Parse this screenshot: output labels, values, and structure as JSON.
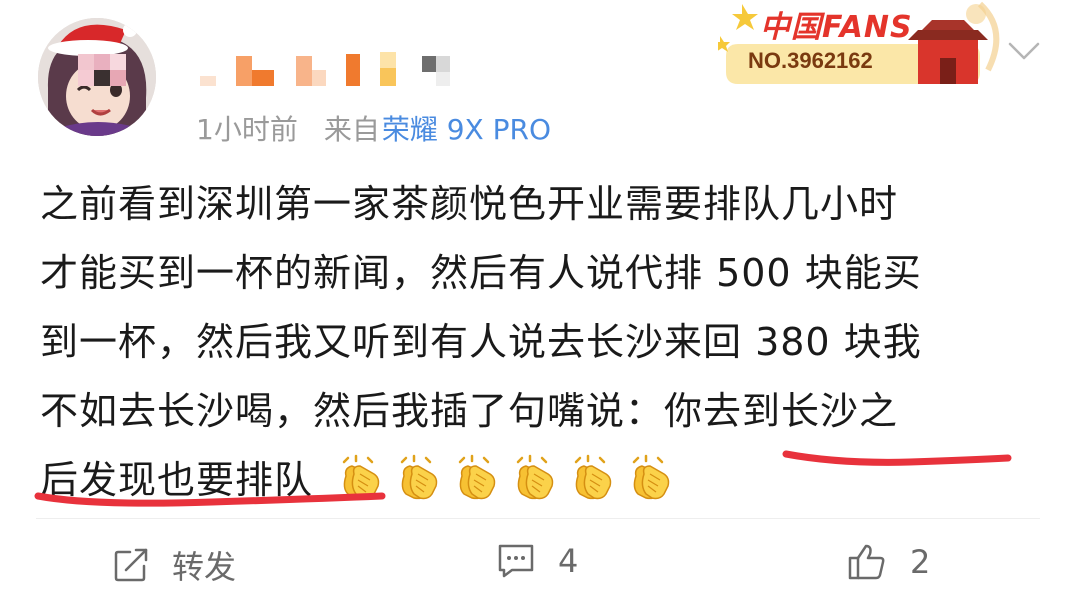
{
  "post": {
    "time": "1小时前",
    "from_prefix": "来自",
    "device": "荣耀 9X PRO",
    "lines": [
      "之前看到深圳第一家茶颜悦色开业需要排队几小时",
      "才能买到一杯的新闻，然后有人说代排 500 块能买",
      "到一杯，然后我又听到有人说去长沙来回 380 块我",
      "不如去长沙喝，然后我插了句嘴说：你去到长沙之",
      "后发现也要排队"
    ],
    "emoji": "clapping-hands",
    "emoji_count": 6
  },
  "badge": {
    "title": "中国FANS",
    "number": "NO.3962162"
  },
  "actions": {
    "repost_label": "转发",
    "comment_count": "4",
    "like_count": "2"
  },
  "colors": {
    "accent_blue": "#4a8be0",
    "underline_red": "#e8323c",
    "badge_red": "#e4342b"
  }
}
